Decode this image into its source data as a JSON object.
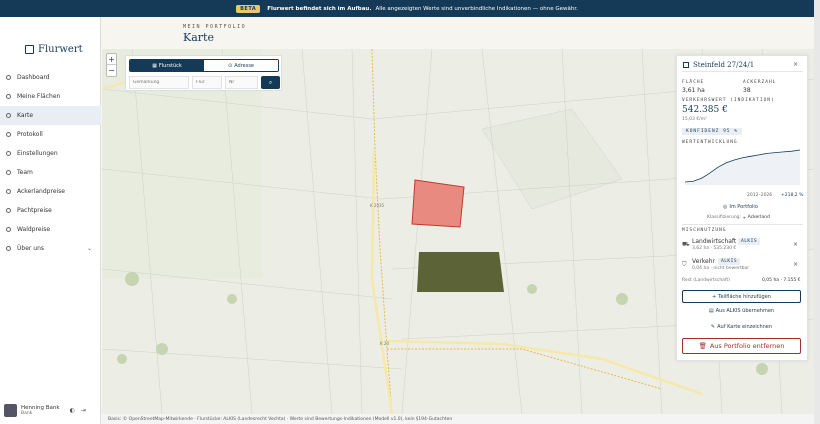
{
  "banner": {
    "badge": "BETA",
    "bold": "Flurwert befindet sich im Aufbau.",
    "text": "Alle angezeigten Werte sind unverbindliche Indikationen — ohne Gewähr."
  },
  "brand": {
    "name": "Flurwert"
  },
  "header": {
    "overline": "MEIN PORTFOLIO",
    "title": "Karte"
  },
  "nav": [
    {
      "label": "Dashboard",
      "icon": "dashboard-icon"
    },
    {
      "label": "Meine Flächen",
      "icon": "pin-icon"
    },
    {
      "label": "Karte",
      "icon": "map-icon",
      "active": true
    },
    {
      "label": "Protokoll",
      "icon": "clock-icon"
    },
    {
      "label": "Einstellungen",
      "icon": "gear-icon"
    },
    {
      "label": "Team",
      "icon": "team-icon"
    },
    {
      "label": "Ackerlandpreise",
      "icon": "chart-icon"
    },
    {
      "label": "Pachtpreise",
      "icon": "chart-icon"
    },
    {
      "label": "Waldpreise",
      "icon": "tree-icon"
    },
    {
      "label": "Über uns",
      "icon": "info-icon"
    }
  ],
  "user": {
    "name": "Henning Bank",
    "role": "Bank"
  },
  "search": {
    "tab_flurstueck": "Flurstück",
    "tab_adresse": "Adresse",
    "ph_gemarkung": "Gemarkung",
    "ph_flur": "Flur",
    "ph_nr": "Nr"
  },
  "map": {
    "zoom_in": "+",
    "zoom_out": "−",
    "road_label_1": "K 2035",
    "road_label_2": "K 20",
    "colors": {
      "selected": "#e88a80",
      "portfolio": "#5c6336",
      "road": "#f6e8a8"
    }
  },
  "footer": "Basis: © OpenStreetMap-Mitwirkende · Flurstücke: ALKIS (Landesrecht Vechta) · Werte sind Bewertungs-Indikationen (Modell v1.0), kein §194-Gutachten",
  "panel": {
    "title": "Steinfeld 27/24/1",
    "flaeche_label": "FLÄCHE",
    "flaeche_value": "3,61 ha",
    "ackerzahl_label": "ACKERZAHL",
    "ackerzahl_value": "38",
    "verkehrswert_label": "VERKEHRSWERT (INDIKATION)",
    "verkehrswert_value": "542.385 €",
    "per_m2": "15,03 €/m²",
    "konfidenz": "KONFIDENZ 95 %",
    "wertentwicklung_label": "WERTENTWICKLUNG",
    "trend_period": "2012–2026",
    "trend_change": "+218,2 %",
    "portfolio_link": "Im Portfolio",
    "klassifizierung_label": "Klassifizierung:",
    "klassifizierung_value": "Ackerland",
    "nutzung_label": "MISCHNUTZUNG",
    "nutzungen": [
      {
        "name": "Landwirtschaft",
        "badge": "ALKIS",
        "detail": "3,62 ha · 535.230 €"
      },
      {
        "name": "Verkehr",
        "badge": "ALKIS",
        "detail": "0,04 ha · nicht bewertbar"
      }
    ],
    "rest_label": "Rest (Landwirtschaft)",
    "rest_value": "0,05 ha · 7.155 €",
    "btn_teilflaeche": "Teilfläche hinzufügen",
    "link_alkis": "Aus ALKIS übernehmen",
    "link_karte": "Auf Karte einzeichnen",
    "btn_remove": "Aus Portfolio entfernen",
    "chart_data": {
      "type": "line",
      "x": [
        2012,
        2013,
        2014,
        2015,
        2016,
        2017,
        2018,
        2019,
        2020,
        2021,
        2022,
        2023,
        2024,
        2025,
        2026
      ],
      "values": [
        1.0,
        1.05,
        1.25,
        1.6,
        2.0,
        2.3,
        2.5,
        2.65,
        2.75,
        2.85,
        2.95,
        3.0,
        3.05,
        3.1,
        3.18
      ]
    }
  }
}
